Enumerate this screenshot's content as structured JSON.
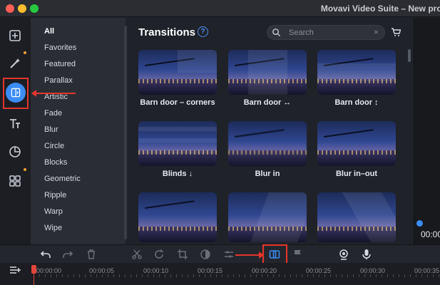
{
  "window": {
    "title": "Movavi Video Suite – New proj"
  },
  "categories": [
    "All",
    "Favorites",
    "Featured",
    "Parallax",
    "Artistic",
    "Fade",
    "Blur",
    "Circle",
    "Blocks",
    "Geometric",
    "Ripple",
    "Warp",
    "Wipe"
  ],
  "panel": {
    "title": "Transitions",
    "help": "?",
    "search_placeholder": "Search",
    "clear": "×"
  },
  "tiles": [
    {
      "label": "Barn door – corners"
    },
    {
      "label": "Barn door ↔"
    },
    {
      "label": "Barn door ↕"
    },
    {
      "label": "Blinds ↓"
    },
    {
      "label": "Blur in"
    },
    {
      "label": "Blur in–out"
    }
  ],
  "preview": {
    "time": "00:00"
  },
  "timeline": {
    "ticks": [
      "00:00:00",
      "00:00:05",
      "00:00:10",
      "00:00:15",
      "00:00:20",
      "00:00:25",
      "00:00:30",
      "00:00:35"
    ]
  },
  "icons": {
    "rail": [
      "import-icon",
      "magic-wand-icon",
      "transitions-icon",
      "titles-icon",
      "stickers-icon",
      "more-tools-icon"
    ],
    "toolbar": [
      "undo-icon",
      "redo-icon",
      "delete-icon",
      "cut-icon",
      "rotate-icon",
      "crop-icon",
      "color-adjust-icon",
      "audio-properties-icon",
      "transition-wizard-icon",
      "marker-icon",
      "webcam-icon",
      "microphone-icon"
    ]
  },
  "colors": {
    "accent": "#3b8cf5",
    "highlight": "#e6352b",
    "background": "#1f2229"
  }
}
